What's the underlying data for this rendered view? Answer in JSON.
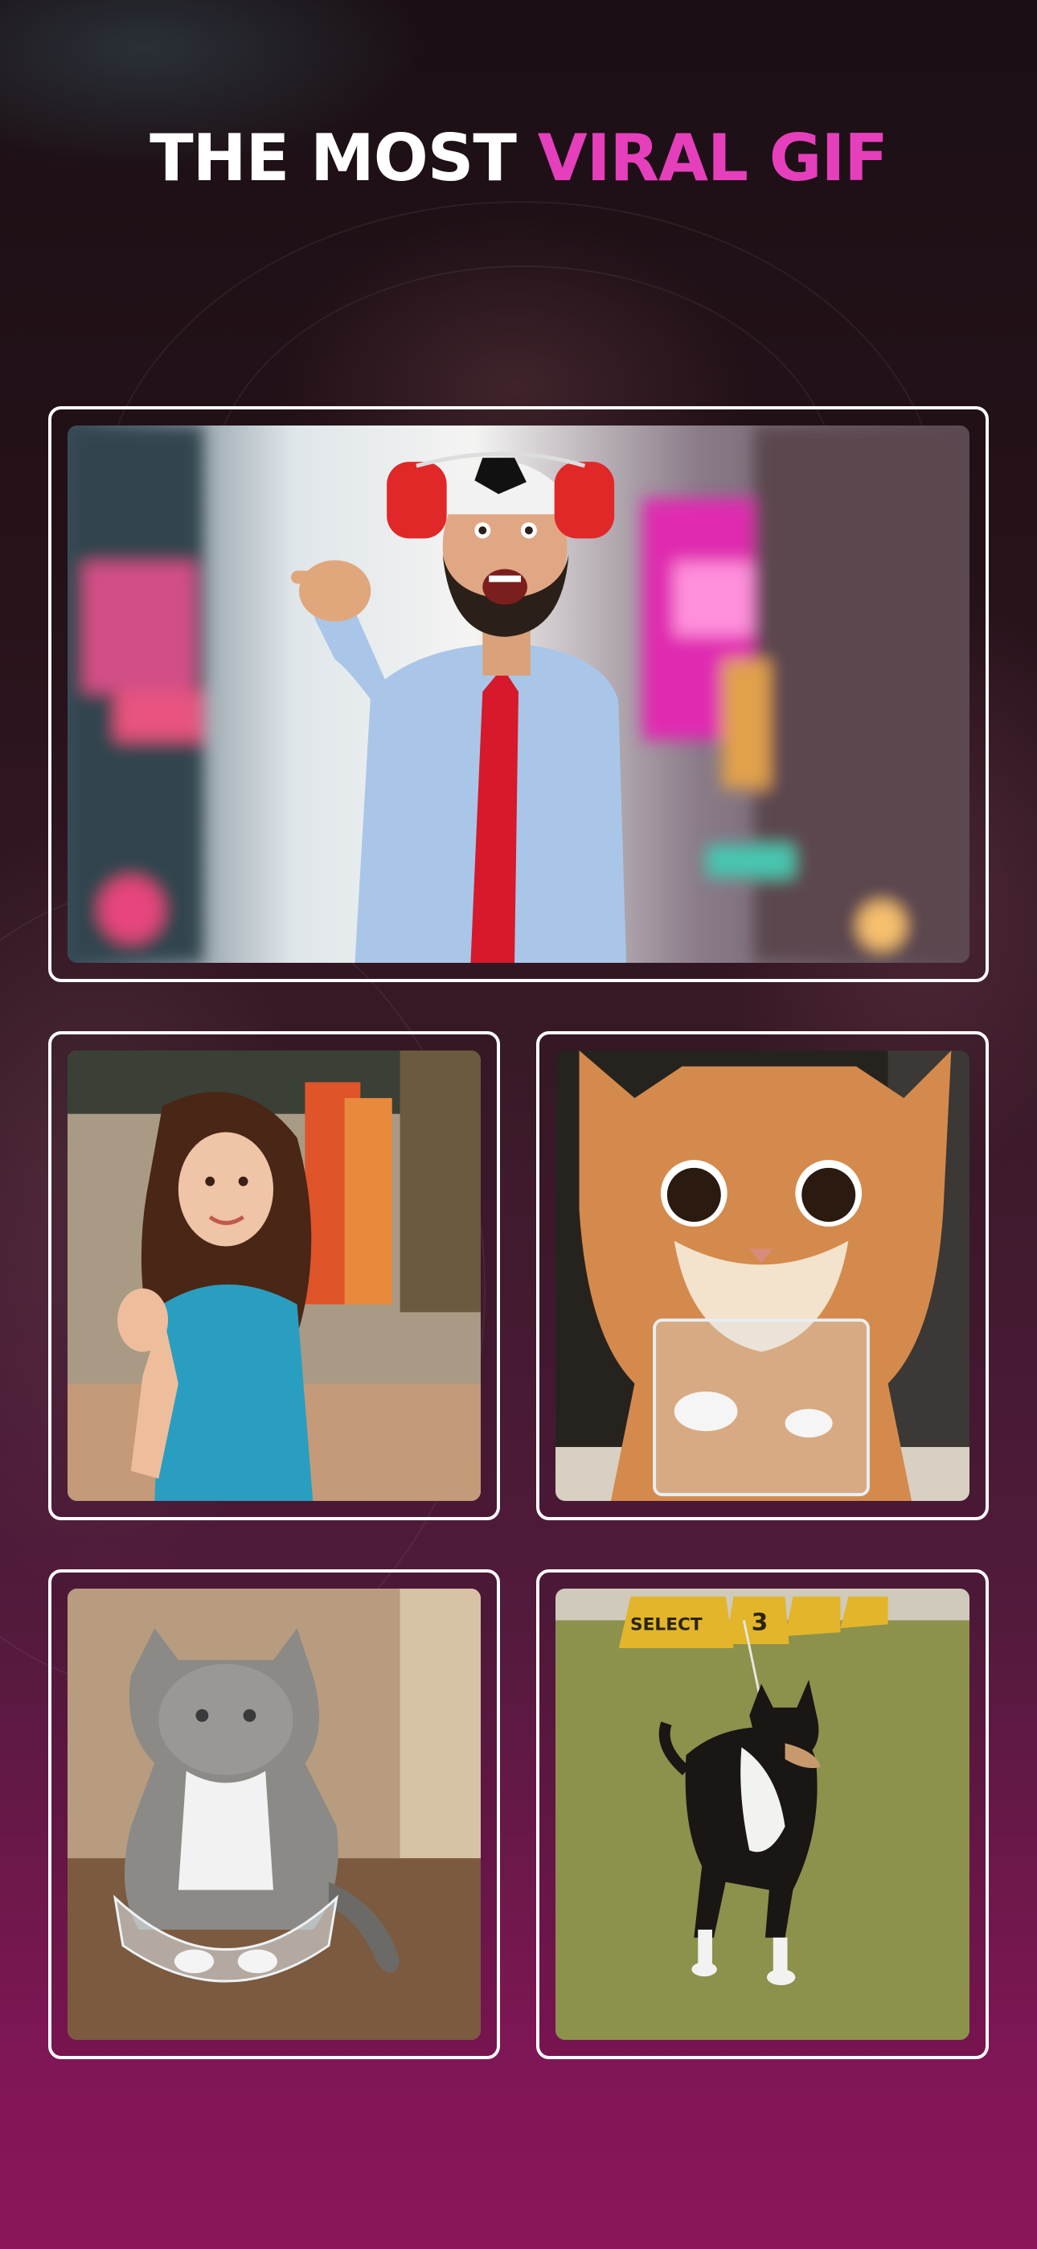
{
  "headline": {
    "part1": "THE MOST ",
    "part2": "VIRAL GIF"
  },
  "colors": {
    "accent": "#e63fbc",
    "card_border": "#ffffff",
    "background_top": "#1a0f15",
    "background_bottom": "#8a1659"
  },
  "gifs": [
    {
      "subject": "pointing-man-with-drink-helmet"
    },
    {
      "subject": "waving-girl"
    },
    {
      "subject": "cat-with-glass"
    },
    {
      "subject": "cat-in-bowl"
    },
    {
      "subject": "running-dog"
    }
  ],
  "dog_scene": {
    "sign_1": "SELECT",
    "sign_2": "3"
  }
}
